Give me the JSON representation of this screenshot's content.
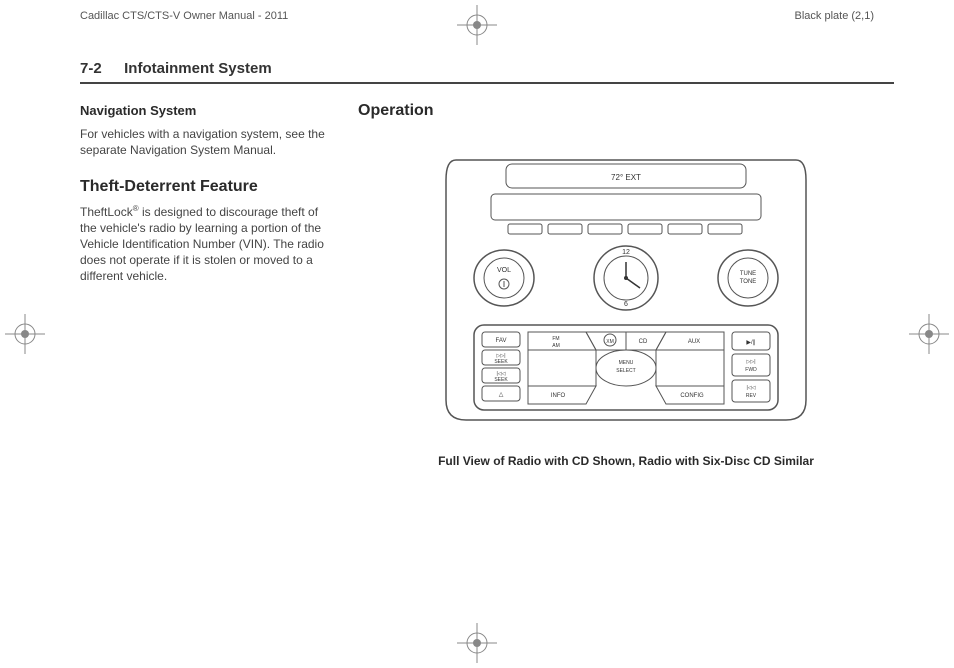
{
  "header": {
    "manual_title": "Cadillac CTS/CTS-V Owner Manual - 2011",
    "plate_label": "Black plate (2,1)"
  },
  "section": {
    "number": "7-2",
    "title": "Infotainment System"
  },
  "left_column": {
    "nav_heading": "Navigation System",
    "nav_body": "For vehicles with a navigation system, see the separate Navigation System Manual.",
    "theft_heading": "Theft-Deterrent Feature",
    "theft_body_pre": "TheftLock",
    "theft_sup": "®",
    "theft_body_post": " is designed to discourage theft of the vehicle's radio by learning a portion of the Vehicle Identification Number (VIN). The radio does not operate if it is stolen or moved to a different vehicle."
  },
  "right_column": {
    "operation_heading": "Operation",
    "caption": "Full View of Radio with CD Shown, Radio with Six-Disc CD Similar"
  },
  "radio": {
    "ext_temp": "72° EXT",
    "vol_label": "VOL",
    "tune_label_top": "TUNE",
    "tune_label_bottom": "TONE",
    "clock_top": "12",
    "clock_bottom": "6",
    "btn_fav": "FAV",
    "btn_seek_up": "▷▷|\nSEEK",
    "btn_seek_down": "|◁◁\nSEEK",
    "btn_eject": "△",
    "btn_fmam": "FM\nAM",
    "btn_xm": "XM",
    "btn_cd": "CD",
    "btn_aux": "AUX",
    "btn_menu": "MENU",
    "btn_select": "SELECT",
    "btn_info": "INFO",
    "btn_config": "CONFIG",
    "btn_play": "▶/∥",
    "btn_fwd": "▷▷|\nFWD",
    "btn_rev": "|◁◁\nREV"
  }
}
